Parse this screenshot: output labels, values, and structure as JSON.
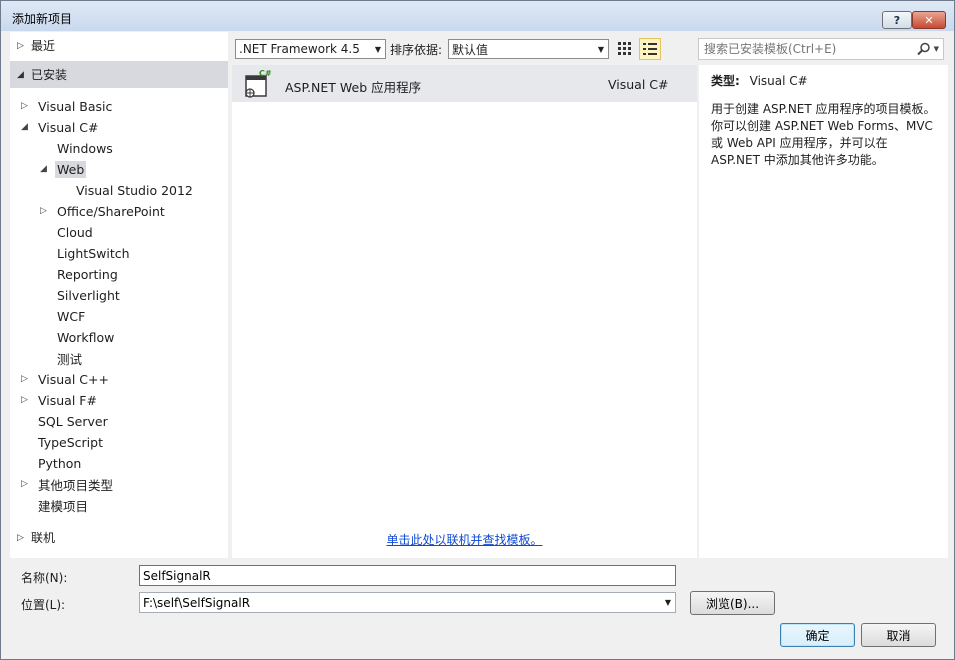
{
  "window": {
    "title": "添加新项目",
    "help_label": "?",
    "close_label": "✕"
  },
  "left_panel": {
    "recent": "最近",
    "installed": "已安装",
    "online": "联机",
    "tree": [
      {
        "label": "Visual Basic",
        "arrow": "▷"
      },
      {
        "label": "Visual C#",
        "arrow": "◢"
      },
      {
        "label": "Windows",
        "arrow": ""
      },
      {
        "label": "Web",
        "arrow": "◢"
      },
      {
        "label": "Visual Studio 2012",
        "arrow": ""
      },
      {
        "label": "Office/SharePoint",
        "arrow": "▷"
      },
      {
        "label": "Cloud",
        "arrow": ""
      },
      {
        "label": "LightSwitch",
        "arrow": ""
      },
      {
        "label": "Reporting",
        "arrow": ""
      },
      {
        "label": "Silverlight",
        "arrow": ""
      },
      {
        "label": "WCF",
        "arrow": ""
      },
      {
        "label": "Workflow",
        "arrow": ""
      },
      {
        "label": "测试",
        "arrow": ""
      },
      {
        "label": "Visual C++",
        "arrow": "▷"
      },
      {
        "label": "Visual F#",
        "arrow": "▷"
      },
      {
        "label": "SQL Server",
        "arrow": ""
      },
      {
        "label": "TypeScript",
        "arrow": ""
      },
      {
        "label": "Python",
        "arrow": ""
      },
      {
        "label": "其他项目类型",
        "arrow": "▷"
      },
      {
        "label": "建模项目",
        "arrow": ""
      }
    ]
  },
  "toolbar": {
    "framework_value": ".NET Framework 4.5",
    "sort_label": "排序依据:",
    "sort_value": "默认值",
    "search_placeholder": "搜索已安装模板(Ctrl+E)"
  },
  "templates": [
    {
      "name": "ASP.NET Web 应用程序",
      "language": "Visual C#",
      "icon_badge": "C#"
    }
  ],
  "online_link": "单击此处以联机并查找模板。",
  "description": {
    "type_label": "类型:",
    "type_value": "Visual C#",
    "text": "用于创建 ASP.NET 应用程序的项目模板。你可以创建 ASP.NET Web Forms、MVC 或 Web API 应用程序，并可以在 ASP.NET 中添加其他许多功能。"
  },
  "form": {
    "name_label": "名称(N):",
    "name_value": "SelfSignalR",
    "location_label": "位置(L):",
    "location_value": "F:\\self\\SelfSignalR",
    "browse_label": "浏览(B)...",
    "ok_label": "确定",
    "cancel_label": "取消"
  },
  "colors": {
    "accent_blue": "#0e49d4",
    "selected_bg": "#d7d9de",
    "focus_border": "#3c7fb1"
  }
}
